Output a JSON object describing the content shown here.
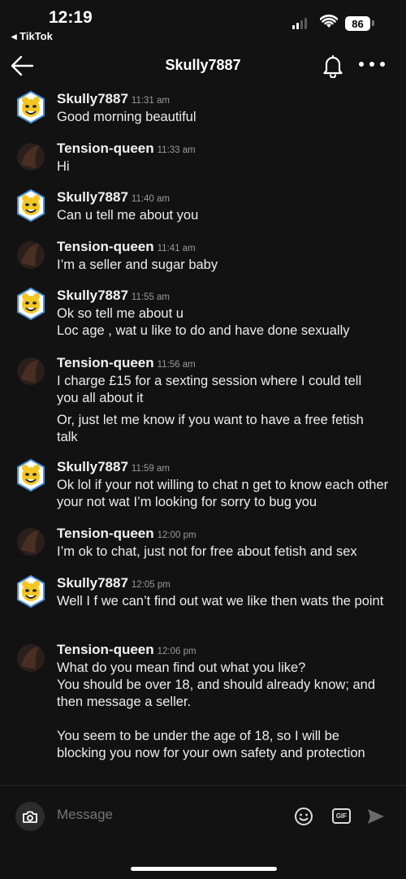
{
  "status_bar": {
    "time": "12:19",
    "back_app": "◂ TikTok",
    "battery": "86"
  },
  "header": {
    "title": "Skully7887"
  },
  "messages": [
    {
      "name": "Skully7887",
      "time": "11:31 am",
      "avatar": "bear-avatar",
      "lines": [
        "Good morning beautiful"
      ]
    },
    {
      "name": "Tension-queen",
      "time": "11:33 am",
      "avatar": "dark-avatar",
      "lines": [
        "Hi"
      ]
    },
    {
      "name": "Skully7887",
      "time": "11:40 am",
      "avatar": "bear-avatar",
      "lines": [
        "Can u tell me about you"
      ]
    },
    {
      "name": "Tension-queen",
      "time": "11:41 am",
      "avatar": "dark-avatar",
      "lines": [
        "I’m a seller and sugar baby"
      ]
    },
    {
      "name": "Skully7887",
      "time": "11:55 am",
      "avatar": "bear-avatar",
      "lines": [
        "Ok so tell me about u",
        "Loc age , wat u like to do and have done sexually"
      ]
    },
    {
      "name": "Tension-queen",
      "time": "11:56 am",
      "avatar": "dark-avatar",
      "lines": [
        "I charge £15 for a sexting session where I could tell you all about it",
        "Or, just let me know if you want to have a free fetish talk"
      ]
    },
    {
      "name": "Skully7887",
      "time": "11:59 am",
      "avatar": "bear-avatar",
      "lines": [
        "Ok lol if your not willing to chat n get to know each other your not wat I’m looking for sorry to bug you"
      ]
    },
    {
      "name": "Tension-queen",
      "time": "12:00 pm",
      "avatar": "dark-avatar",
      "lines": [
        "I’m ok to chat, just not for free about fetish and sex"
      ]
    },
    {
      "name": "Skully7887",
      "time": "12:05 pm",
      "avatar": "bear-avatar",
      "lines": [
        "Well I f we can’t find out wat we like then wats the point"
      ]
    },
    {
      "name": "Tension-queen",
      "time": "12:06 pm",
      "avatar": "dark-avatar",
      "lines": [
        "What do you mean find out what you like?",
        "You should be over 18, and should already know; and then message a seller.",
        "You seem to be under the age of 18, so I will be blocking you now for your own safety and protection"
      ]
    }
  ],
  "composer": {
    "placeholder": "Message",
    "gif_label": "GIF"
  },
  "icons": [
    "back-arrow-icon",
    "bell-icon",
    "more-icon",
    "camera-icon",
    "emoji-icon",
    "gif-icon",
    "send-icon"
  ],
  "colors": {
    "background": "#121212",
    "text": "#ececec",
    "timestamp": "#9a9a9a"
  }
}
